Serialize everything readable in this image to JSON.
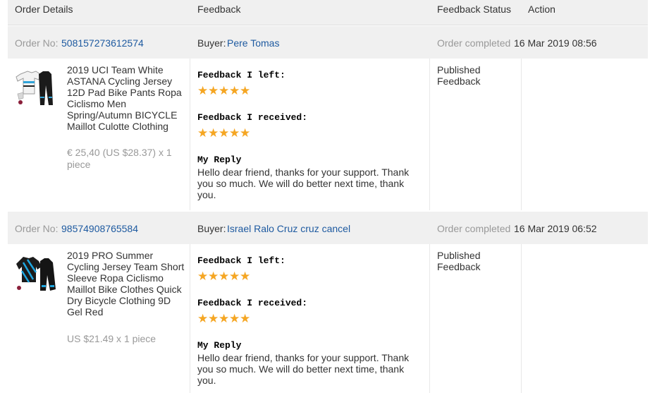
{
  "header": {
    "order_details": "Order Details",
    "feedback": "Feedback",
    "feedback_status": "Feedback Status",
    "action": "Action"
  },
  "orders": [
    {
      "order_no_label": "Order No:",
      "order_no": "508157273612574",
      "buyer_label": "Buyer:",
      "buyer": "Pere Tomas",
      "status_label": "Order completed",
      "completed_at": "16 Mar 2019 08:56",
      "product_title": "2019 UCI Team White ASTANA Cycling Jersey 12D Pad Bike Pants Ropa Ciclismo Men Spring/Autumn BICYCLE Maillot Culotte Clothing",
      "price": "€ 25,40 (US $28.37) x 1 piece",
      "thumbnail_icon": "cycling-kit-white-icon",
      "feedback_left_label": "Feedback I left:",
      "feedback_left_stars": 5,
      "feedback_received_label": "Feedback I received:",
      "feedback_received_stars": 5,
      "reply_label": "My Reply",
      "reply_text": "Hello dear friend, thanks for your support. Thank you so much. We will do better next time, thank you.",
      "feedback_status": "Published Feedback"
    },
    {
      "order_no_label": "Order No:",
      "order_no": "98574908765584",
      "buyer_label": "Buyer:",
      "buyer": "Israel Ralo Cruz cruz cancel",
      "status_label": "Order completed",
      "completed_at": "16 Mar 2019 06:52",
      "product_title": "2019 PRO Summer Cycling Jersey Team Short Sleeve Ropa Ciclismo Maillot Bike Clothes Quick Dry Bicycle Clothing 9D Gel Red",
      "price": "US $21.49 x 1 piece",
      "thumbnail_icon": "cycling-kit-blue-icon",
      "feedback_left_label": "Feedback I left:",
      "feedback_left_stars": 5,
      "feedback_received_label": "Feedback I received:",
      "feedback_received_stars": 5,
      "reply_label": "My Reply",
      "reply_text": "Hello dear friend, thanks for your support. Thank you so much. We will do better next time, thank you.",
      "feedback_status": "Published Feedback"
    }
  ],
  "colors": {
    "link": "#1e5aa0",
    "star": "#f5a623",
    "muted": "#999999",
    "row_bg": "#f0f0f0"
  }
}
